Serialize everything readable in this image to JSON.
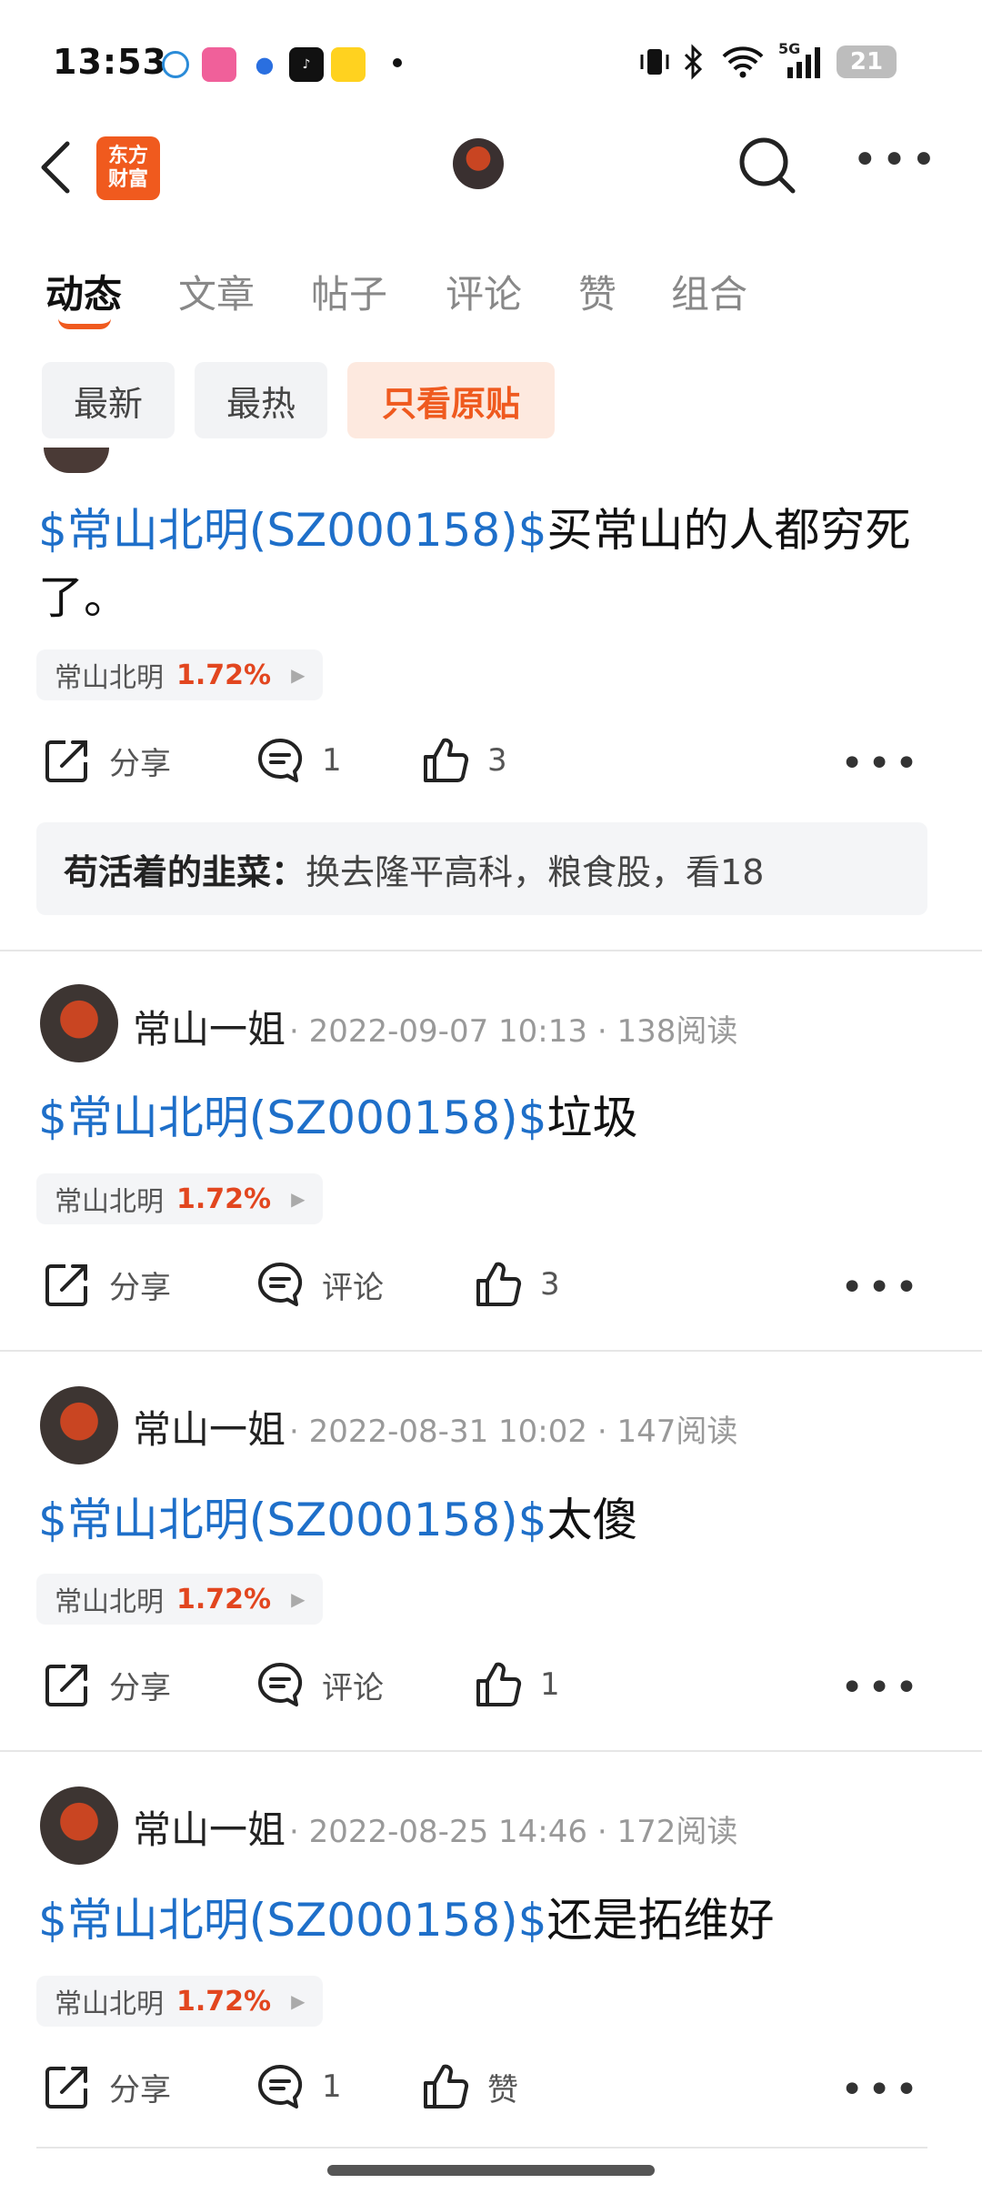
{
  "status_bar": {
    "time": "13:53",
    "network": "5G",
    "battery": "21"
  },
  "nav": {
    "logo_text": "东方\n财富"
  },
  "tabs": [
    {
      "label": "动态"
    },
    {
      "label": "文章"
    },
    {
      "label": "帖子"
    },
    {
      "label": "评论"
    },
    {
      "label": "赞"
    },
    {
      "label": "组合"
    }
  ],
  "filters": [
    {
      "label": "最新"
    },
    {
      "label": "最热"
    },
    {
      "label": "只看原贴"
    }
  ],
  "posts": [
    {
      "stock_link": "$常山北明(SZ000158)$",
      "text_line1": "买常山的人都穷死",
      "text_line2": "了。",
      "tag_name": "常山北明",
      "tag_pct": "1.72%",
      "share": "分享",
      "comment": "1",
      "like": "3",
      "reply_user": "苟活着的韭菜：",
      "reply_text": "换去隆平高科，粮食股，看18"
    },
    {
      "user": "常山一姐",
      "time": "2022-09-07 10:13",
      "reads": "138阅读",
      "stock_link": "$常山北明(SZ000158)$",
      "text": "垃圾",
      "tag_name": "常山北明",
      "tag_pct": "1.72%",
      "share": "分享",
      "comment": "评论",
      "like": "3"
    },
    {
      "user": "常山一姐",
      "time": "2022-08-31 10:02",
      "reads": "147阅读",
      "stock_link": "$常山北明(SZ000158)$",
      "text": "太傻",
      "tag_name": "常山北明",
      "tag_pct": "1.72%",
      "share": "分享",
      "comment": "评论",
      "like": "1"
    },
    {
      "user": "常山一姐",
      "time": "2022-08-25 14:46",
      "reads": "172阅读",
      "stock_link": "$常山北明(SZ000158)$",
      "text": "还是拓维好",
      "tag_name": "常山北明",
      "tag_pct": "1.72%",
      "share": "分享",
      "comment": "1",
      "like": "赞"
    }
  ],
  "colors": {
    "accent": "#f05a1e",
    "link": "#1e6fc9",
    "up": "#e2461f"
  },
  "icons": [
    "back-icon",
    "search-icon",
    "more-icon",
    "share-icon",
    "comment-icon",
    "like-icon"
  ]
}
